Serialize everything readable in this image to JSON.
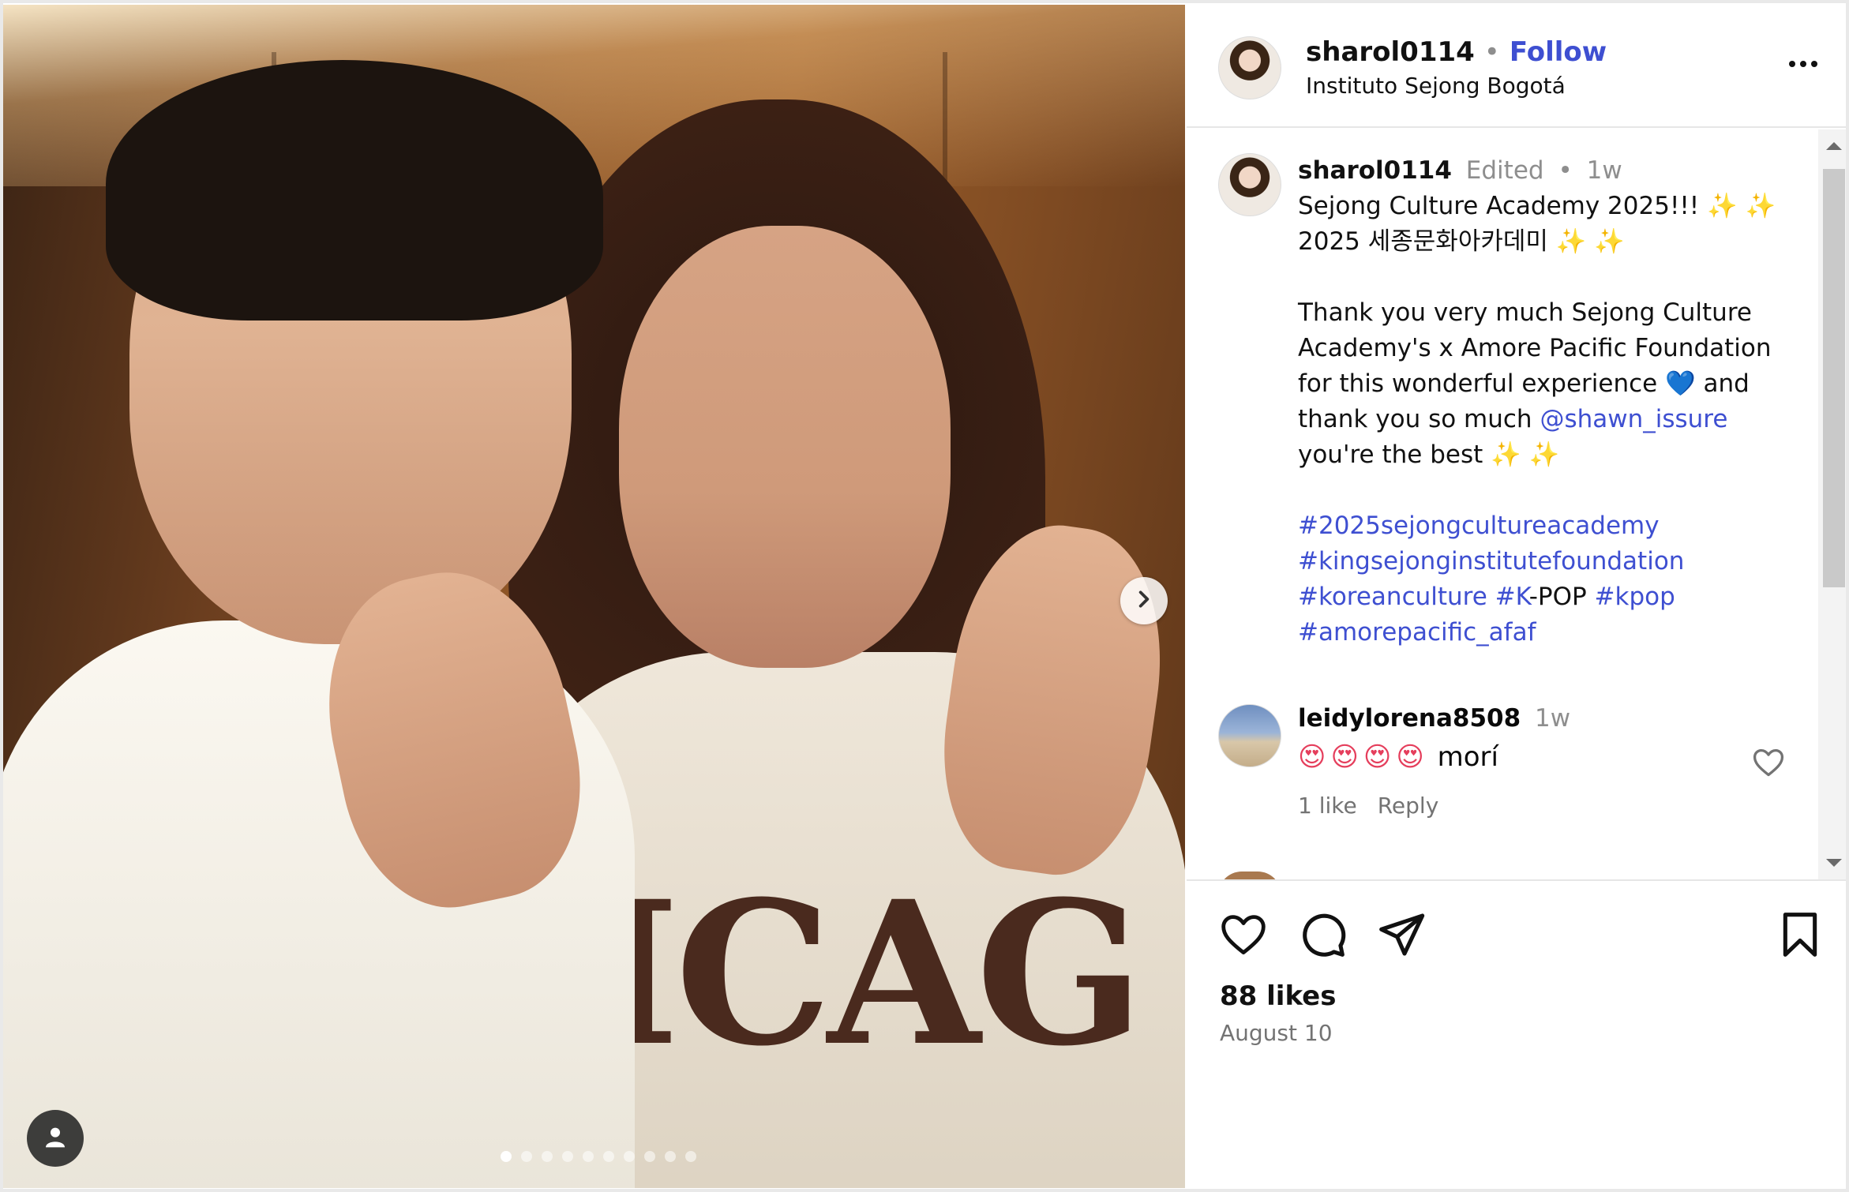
{
  "post": {
    "author": "sharol0114",
    "separator": "•",
    "follow_label": "Follow",
    "location": "Instituto Sejong Bogotá"
  },
  "media": {
    "sweatshirt_text": "ICAG",
    "carousel_dots": 10,
    "active_dot": 1,
    "icons": {
      "next": "chevron-right-icon",
      "tagged_users": "person-icon"
    }
  },
  "caption": {
    "username": "sharol0114",
    "edited": "Edited",
    "dot": "•",
    "time": "1w",
    "line1_text": "Sejong Culture Academy 2025!!! ",
    "line1_emoji": "✨ ✨",
    "line2_text": "2025 세종문화아카데미 ",
    "line2_emoji": "✨ ✨",
    "line3": "Thank you very much Sejong Culture",
    "line4": "Academy's x Amore Pacific Foundation",
    "line5_text": "for this wonderful experience ",
    "line5_heart": "💙",
    "line5_after": "  and",
    "line6_text": "thank you so much ",
    "line6_mention": "@shawn_issure",
    "line7_text": "you're the best ",
    "line7_emoji": "✨ ✨",
    "hashtag1": "#2025sejongcultureacademy",
    "hashtag2": "#kingsejonginstitutefoundation",
    "hashtag3a": "#koreanculture",
    "hashtag3b": " #K",
    "hashtag3c": "-POP ",
    "hashtag3d": "#kpop",
    "hashtag4": "#amorepacific_afaf"
  },
  "comment": {
    "username": "leidylorena8508",
    "time": "1w",
    "emojis": "😍😍😍😍",
    "text": "morí",
    "likes": "1 like",
    "reply_label": "Reply"
  },
  "footer": {
    "likes": "88 likes",
    "date": "August 10",
    "icons": {
      "like": "heart-icon",
      "comment": "comment-icon",
      "share": "send-icon",
      "save": "bookmark-icon"
    }
  },
  "colors": {
    "link": "#3e4fd1",
    "muted": "#8e8e8e",
    "text": "#111111"
  }
}
